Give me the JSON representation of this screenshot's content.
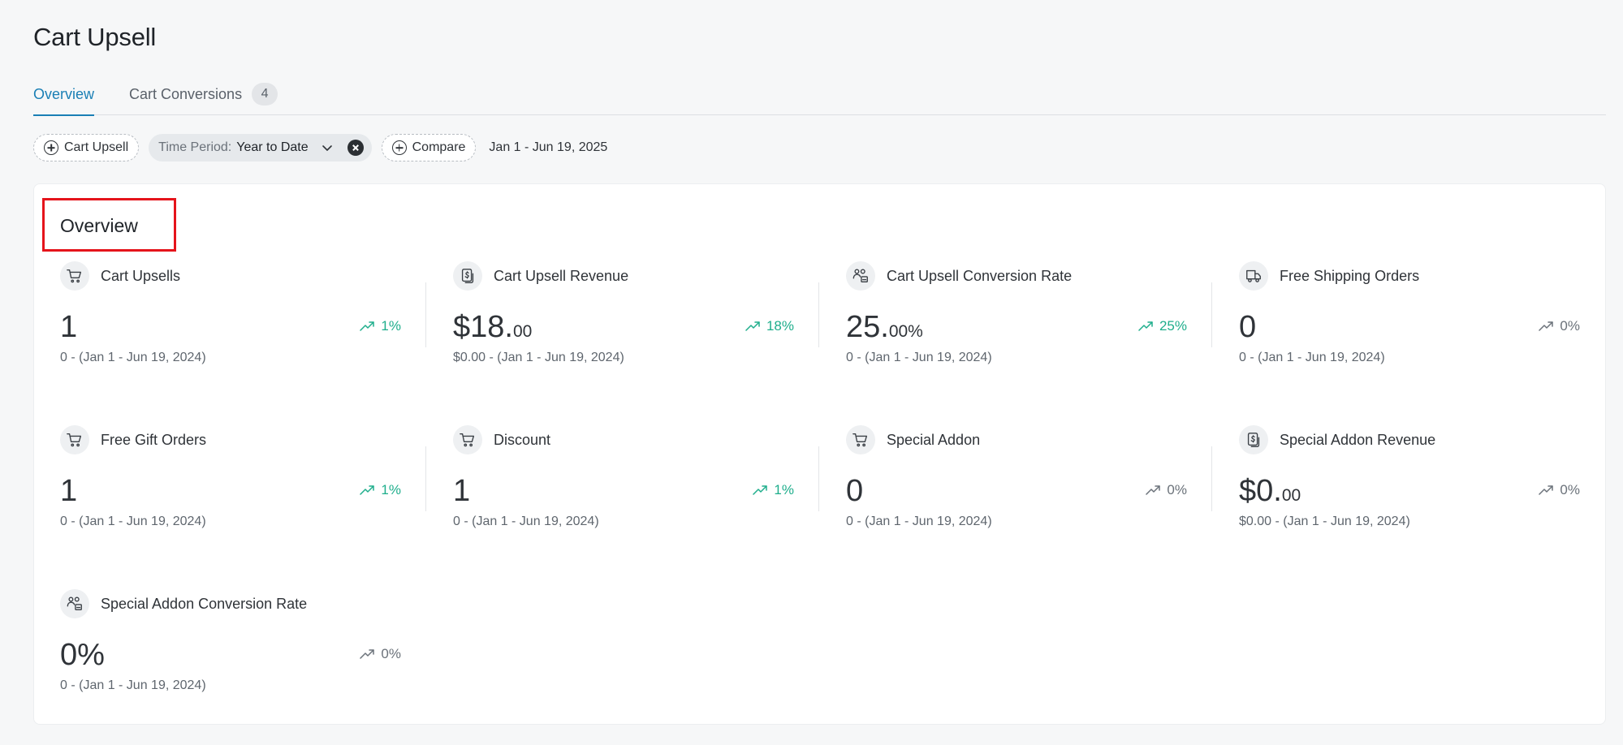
{
  "page": {
    "title": "Cart Upsell"
  },
  "tabs": [
    {
      "label": "Overview",
      "active": true
    },
    {
      "label": "Cart Conversions",
      "count": "4"
    }
  ],
  "filters": {
    "cart_upsell_label": "Cart Upsell",
    "time_period_key": "Time Period:",
    "time_period_value": "Year to Date",
    "compare_label": "Compare",
    "date_range": "Jan 1 - Jun 19, 2025"
  },
  "overview": {
    "title": "Overview",
    "metrics": [
      {
        "label": "Cart Upsells",
        "icon": "cart-icon",
        "value_main": "1",
        "value_small": "",
        "delta": "1%",
        "trend": "up",
        "compare": "0 - (Jan 1 - Jun 19, 2024)"
      },
      {
        "label": "Cart Upsell Revenue",
        "icon": "revenue-icon",
        "value_main": "$18.",
        "value_small": "00",
        "delta": "18%",
        "trend": "up",
        "compare": "$0.00 - (Jan 1 - Jun 19, 2024)"
      },
      {
        "label": "Cart Upsell Conversion Rate",
        "icon": "users-rate-icon",
        "value_main": "25.",
        "value_small": "00%",
        "delta": "25%",
        "trend": "up",
        "compare": "0 - (Jan 1 - Jun 19, 2024)"
      },
      {
        "label": "Free Shipping Orders",
        "icon": "truck-icon",
        "value_main": "0",
        "value_small": "",
        "delta": "0%",
        "trend": "flat",
        "compare": "0 - (Jan 1 - Jun 19, 2024)"
      },
      {
        "label": "Free Gift Orders",
        "icon": "cart-icon",
        "value_main": "1",
        "value_small": "",
        "delta": "1%",
        "trend": "up",
        "compare": "0 - (Jan 1 - Jun 19, 2024)"
      },
      {
        "label": "Discount",
        "icon": "cart-icon",
        "value_main": "1",
        "value_small": "",
        "delta": "1%",
        "trend": "up",
        "compare": "0 - (Jan 1 - Jun 19, 2024)"
      },
      {
        "label": "Special Addon",
        "icon": "cart-icon",
        "value_main": "0",
        "value_small": "",
        "delta": "0%",
        "trend": "flat",
        "compare": "0 - (Jan 1 - Jun 19, 2024)"
      },
      {
        "label": "Special Addon Revenue",
        "icon": "revenue-icon",
        "value_main": "$0.",
        "value_small": "00",
        "delta": "0%",
        "trend": "flat",
        "compare": "$0.00 - (Jan 1 - Jun 19, 2024)"
      },
      {
        "label": "Special Addon Conversion Rate",
        "icon": "users-rate-icon",
        "value_main": "0%",
        "value_small": "",
        "delta": "0%",
        "trend": "flat",
        "compare": "0 - (Jan 1 - Jun 19, 2024)"
      }
    ]
  },
  "colors": {
    "accent": "#1a7fb5",
    "trend_up": "#1fae8c",
    "highlight": "#e5141b"
  }
}
